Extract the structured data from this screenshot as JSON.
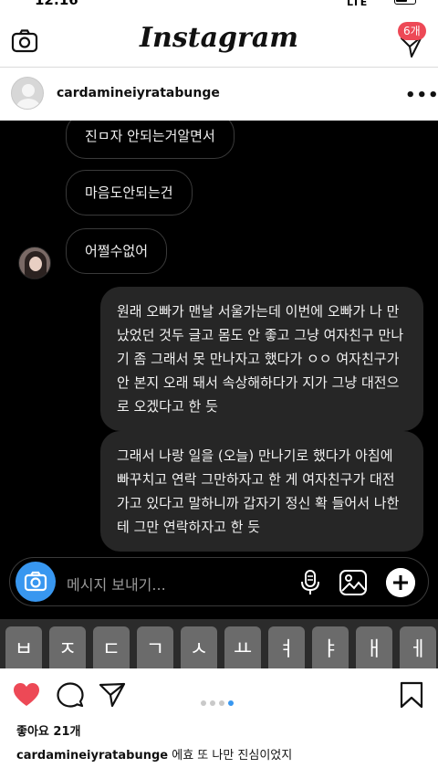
{
  "status_bar": {
    "time": "12:16",
    "network": "LTE"
  },
  "app": {
    "title": "Instagram",
    "dm_badge": "6개"
  },
  "post": {
    "username": "cardamineiyratabunge",
    "likes": "좋아요 21개",
    "caption_user": "cardamineiyratabunge",
    "caption_text": "에효 또 나만 진심이었지",
    "carousel": {
      "count": 4,
      "active_index": 3
    }
  },
  "chat": {
    "incoming": [
      "진ㅁ자 안되는거알면서",
      "마음도안되는건",
      "어쩔수없어"
    ],
    "outgoing": [
      "원래 오빠가 맨날 서울가는데 이번에 오빠가 나 만났었던 것두 글고 몸도 안 좋고 그냥 여자친구 만나기 좀 그래서 못 만나자고 했다가 ㅇㅇ 여자친구가 안 본지 오래 돼서 속상해하다가 지가 그냥 대전으로 오겠다고 한 듯",
      "그래서 나랑 일을 (오늘) 만나기로 했다가 아침에 빠꾸치고 연락 그만하자고 한 게 여자친구가 대전 가고 있다고 말하니까 갑자기 정신 확 들어서 나한테 그만 연락하자고 한 듯"
    ],
    "composer_placeholder": "메시지 보내기...",
    "keyboard_keys": [
      "ㅂ",
      "ㅈ",
      "ㄷ",
      "ㄱ",
      "ㅅ",
      "ㅛ",
      "ㅕ",
      "ㅑ",
      "ㅐ",
      "ㅔ"
    ]
  },
  "colors": {
    "accent": "#3897f0",
    "like": "#ed4956",
    "chat_bg": "#000000",
    "bubble_out": "#262626"
  }
}
